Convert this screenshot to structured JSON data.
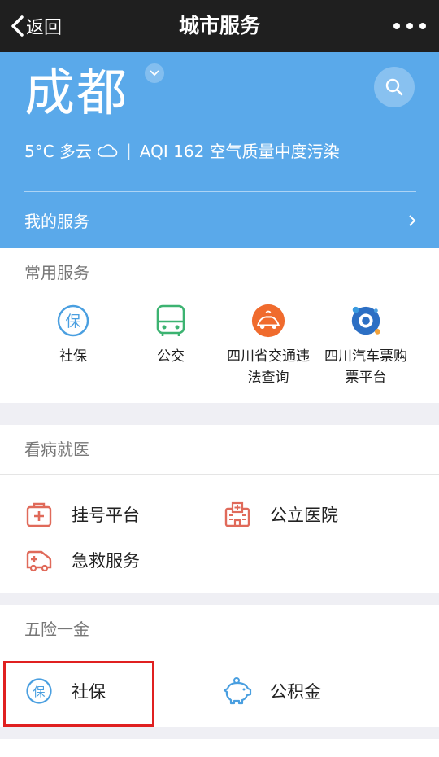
{
  "nav": {
    "back_label": "返回",
    "title": "城市服务",
    "more_icon": "more-icon"
  },
  "hero": {
    "city": "成都",
    "weather": {
      "temp": "5°C 多云",
      "sep": "|",
      "aqi": "AQI 162 空气质量中度污染"
    },
    "my_services": "我的服务",
    "bg_color": "#5aa9ea"
  },
  "common": {
    "title": "常用服务",
    "items": [
      {
        "label": "社保",
        "icon": "social-security-icon"
      },
      {
        "label": "公交",
        "icon": "bus-icon"
      },
      {
        "label": "四川省交通违法查询",
        "icon": "traffic-violation-icon"
      },
      {
        "label": "四川汽车票购票平台",
        "icon": "bus-ticket-icon"
      }
    ]
  },
  "clinic": {
    "title": "看病就医",
    "items": [
      {
        "label": "挂号平台",
        "icon": "registration-icon"
      },
      {
        "label": "公立医院",
        "icon": "hospital-icon"
      },
      {
        "label": "急救服务",
        "icon": "ambulance-icon"
      }
    ]
  },
  "five": {
    "title": "五险一金",
    "items": [
      {
        "label": "社保",
        "icon": "social-security-icon"
      },
      {
        "label": "公积金",
        "icon": "piggy-bank-icon"
      }
    ]
  },
  "colors": {
    "accent_red": "#e06a5a",
    "accent_blue": "#4a9fe0",
    "accent_green": "#3cb371",
    "highlight": "#e02020"
  }
}
